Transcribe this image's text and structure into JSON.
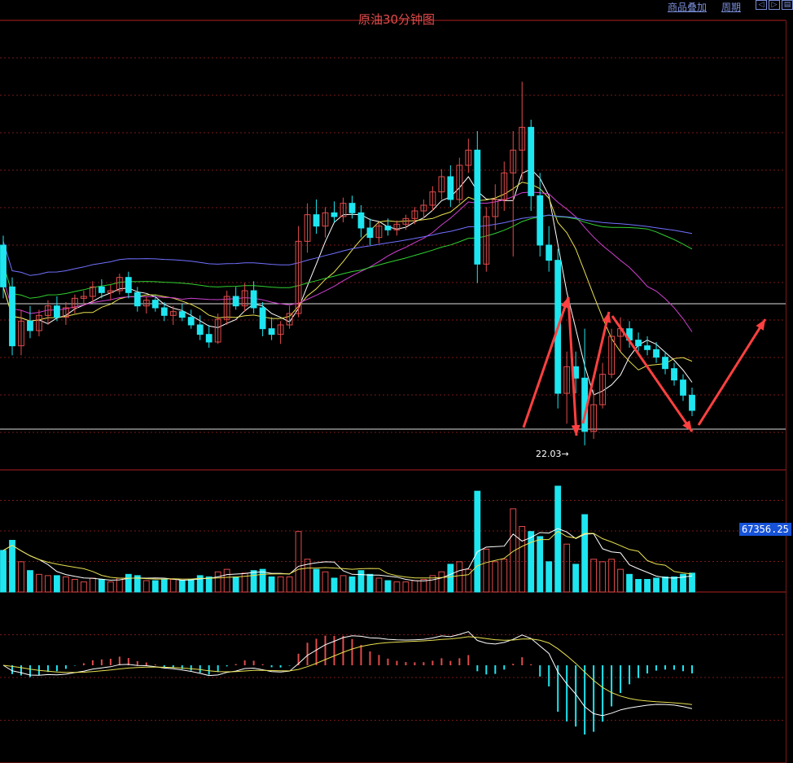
{
  "header": {
    "title": "原油30分钟图",
    "link_overlay": "商品叠加",
    "link_period": "周期",
    "nav_icons": [
      "prev-icon",
      "next-icon",
      "bars-icon"
    ]
  },
  "labels": {
    "low_price": "22.03→",
    "current_volume": "67356.25"
  },
  "colors": {
    "up": "#e24b4b",
    "down": "#1ee6f0",
    "grid": "#7a1818",
    "ma5": "#ffffff",
    "ma10": "#e8e050",
    "ma20": "#d040d0",
    "ma40": "#30d030",
    "ma60": "#7070ff",
    "annotation": "#ff4040"
  },
  "chart_data": {
    "type": "candlestick",
    "title": "原油30分钟图",
    "price_lows_marked": [
      22.03
    ],
    "candles_ohlc": [
      [
        27.3,
        27.55,
        25.9,
        26.2
      ],
      [
        26.2,
        26.45,
        24.4,
        24.65
      ],
      [
        24.65,
        25.6,
        24.4,
        25.3
      ],
      [
        25.3,
        25.7,
        24.85,
        25.05
      ],
      [
        25.05,
        25.6,
        24.9,
        25.45
      ],
      [
        25.45,
        25.85,
        25.2,
        25.7
      ],
      [
        25.7,
        25.95,
        25.3,
        25.4
      ],
      [
        25.4,
        25.8,
        25.2,
        25.65
      ],
      [
        25.65,
        26.0,
        25.5,
        25.9
      ],
      [
        25.9,
        26.1,
        25.7,
        25.95
      ],
      [
        25.95,
        26.35,
        25.8,
        26.2
      ],
      [
        26.2,
        26.4,
        25.9,
        26.05
      ],
      [
        26.05,
        26.25,
        25.85,
        26.1
      ],
      [
        26.1,
        26.55,
        26.0,
        26.45
      ],
      [
        26.45,
        26.6,
        25.9,
        26.05
      ],
      [
        26.05,
        26.2,
        25.55,
        25.7
      ],
      [
        25.7,
        25.95,
        25.5,
        25.85
      ],
      [
        25.85,
        26.0,
        25.55,
        25.65
      ],
      [
        25.65,
        25.8,
        25.3,
        25.45
      ],
      [
        25.45,
        25.7,
        25.2,
        25.55
      ],
      [
        25.55,
        25.75,
        25.3,
        25.4
      ],
      [
        25.4,
        25.6,
        25.1,
        25.2
      ],
      [
        25.2,
        25.45,
        24.8,
        24.95
      ],
      [
        24.95,
        25.2,
        24.6,
        24.75
      ],
      [
        24.75,
        25.5,
        24.7,
        25.35
      ],
      [
        25.35,
        26.1,
        25.2,
        25.95
      ],
      [
        25.95,
        26.2,
        25.6,
        25.7
      ],
      [
        25.7,
        26.3,
        25.55,
        26.1
      ],
      [
        26.1,
        26.35,
        25.5,
        25.65
      ],
      [
        25.65,
        25.8,
        24.9,
        25.1
      ],
      [
        25.1,
        25.4,
        24.8,
        24.95
      ],
      [
        24.95,
        25.3,
        24.7,
        25.2
      ],
      [
        25.2,
        25.7,
        25.1,
        25.5
      ],
      [
        25.5,
        27.8,
        25.4,
        27.4
      ],
      [
        27.4,
        28.4,
        27.1,
        28.1
      ],
      [
        28.1,
        28.5,
        27.6,
        27.8
      ],
      [
        27.8,
        28.3,
        27.5,
        28.15
      ],
      [
        28.15,
        28.45,
        27.9,
        28.05
      ],
      [
        28.05,
        28.55,
        27.9,
        28.4
      ],
      [
        28.4,
        28.6,
        28.0,
        28.15
      ],
      [
        28.15,
        28.35,
        27.5,
        27.75
      ],
      [
        27.75,
        28.0,
        27.3,
        27.5
      ],
      [
        27.5,
        27.9,
        27.35,
        27.8
      ],
      [
        27.8,
        28.0,
        27.55,
        27.7
      ],
      [
        27.7,
        27.95,
        27.55,
        27.85
      ],
      [
        27.85,
        28.1,
        27.7,
        28.0
      ],
      [
        28.0,
        28.3,
        27.85,
        28.2
      ],
      [
        28.2,
        28.5,
        28.0,
        28.35
      ],
      [
        28.35,
        28.85,
        28.2,
        28.7
      ],
      [
        28.7,
        29.3,
        28.5,
        29.1
      ],
      [
        29.1,
        29.4,
        28.3,
        28.5
      ],
      [
        28.5,
        29.6,
        28.4,
        29.4
      ],
      [
        29.4,
        30.1,
        29.2,
        29.8
      ],
      [
        29.8,
        30.3,
        26.3,
        26.8
      ],
      [
        26.8,
        28.3,
        26.6,
        28.05
      ],
      [
        28.05,
        28.9,
        27.7,
        28.5
      ],
      [
        28.5,
        29.5,
        28.2,
        29.2
      ],
      [
        29.2,
        30.3,
        27.0,
        29.8
      ],
      [
        29.8,
        31.6,
        29.0,
        30.4
      ],
      [
        30.4,
        30.6,
        28.2,
        28.6
      ],
      [
        28.6,
        29.2,
        27.0,
        27.3
      ],
      [
        27.3,
        27.8,
        26.6,
        26.9
      ],
      [
        26.9,
        27.2,
        23.0,
        23.4
      ],
      [
        23.4,
        24.5,
        22.6,
        24.1
      ],
      [
        24.1,
        24.5,
        23.4,
        23.8
      ],
      [
        23.8,
        25.1,
        22.03,
        22.4
      ],
      [
        22.4,
        23.5,
        22.2,
        23.1
      ],
      [
        23.1,
        24.2,
        23.0,
        23.9
      ],
      [
        23.9,
        25.1,
        23.8,
        24.9
      ],
      [
        24.9,
        25.4,
        24.5,
        25.1
      ],
      [
        25.1,
        25.3,
        24.6,
        24.8
      ],
      [
        24.8,
        25.0,
        24.5,
        24.65
      ],
      [
        24.65,
        24.9,
        24.4,
        24.55
      ],
      [
        24.55,
        24.75,
        24.2,
        24.35
      ],
      [
        24.35,
        24.5,
        23.9,
        24.05
      ],
      [
        24.05,
        24.2,
        23.6,
        23.75
      ],
      [
        23.75,
        23.9,
        23.2,
        23.35
      ],
      [
        23.35,
        23.55,
        22.8,
        22.95
      ]
    ],
    "volume_label": "67356.25",
    "panels": [
      "price",
      "volume",
      "macd"
    ],
    "moving_averages": [
      "MA5",
      "MA10",
      "MA20",
      "MA40",
      "MA60"
    ],
    "grid": true
  }
}
